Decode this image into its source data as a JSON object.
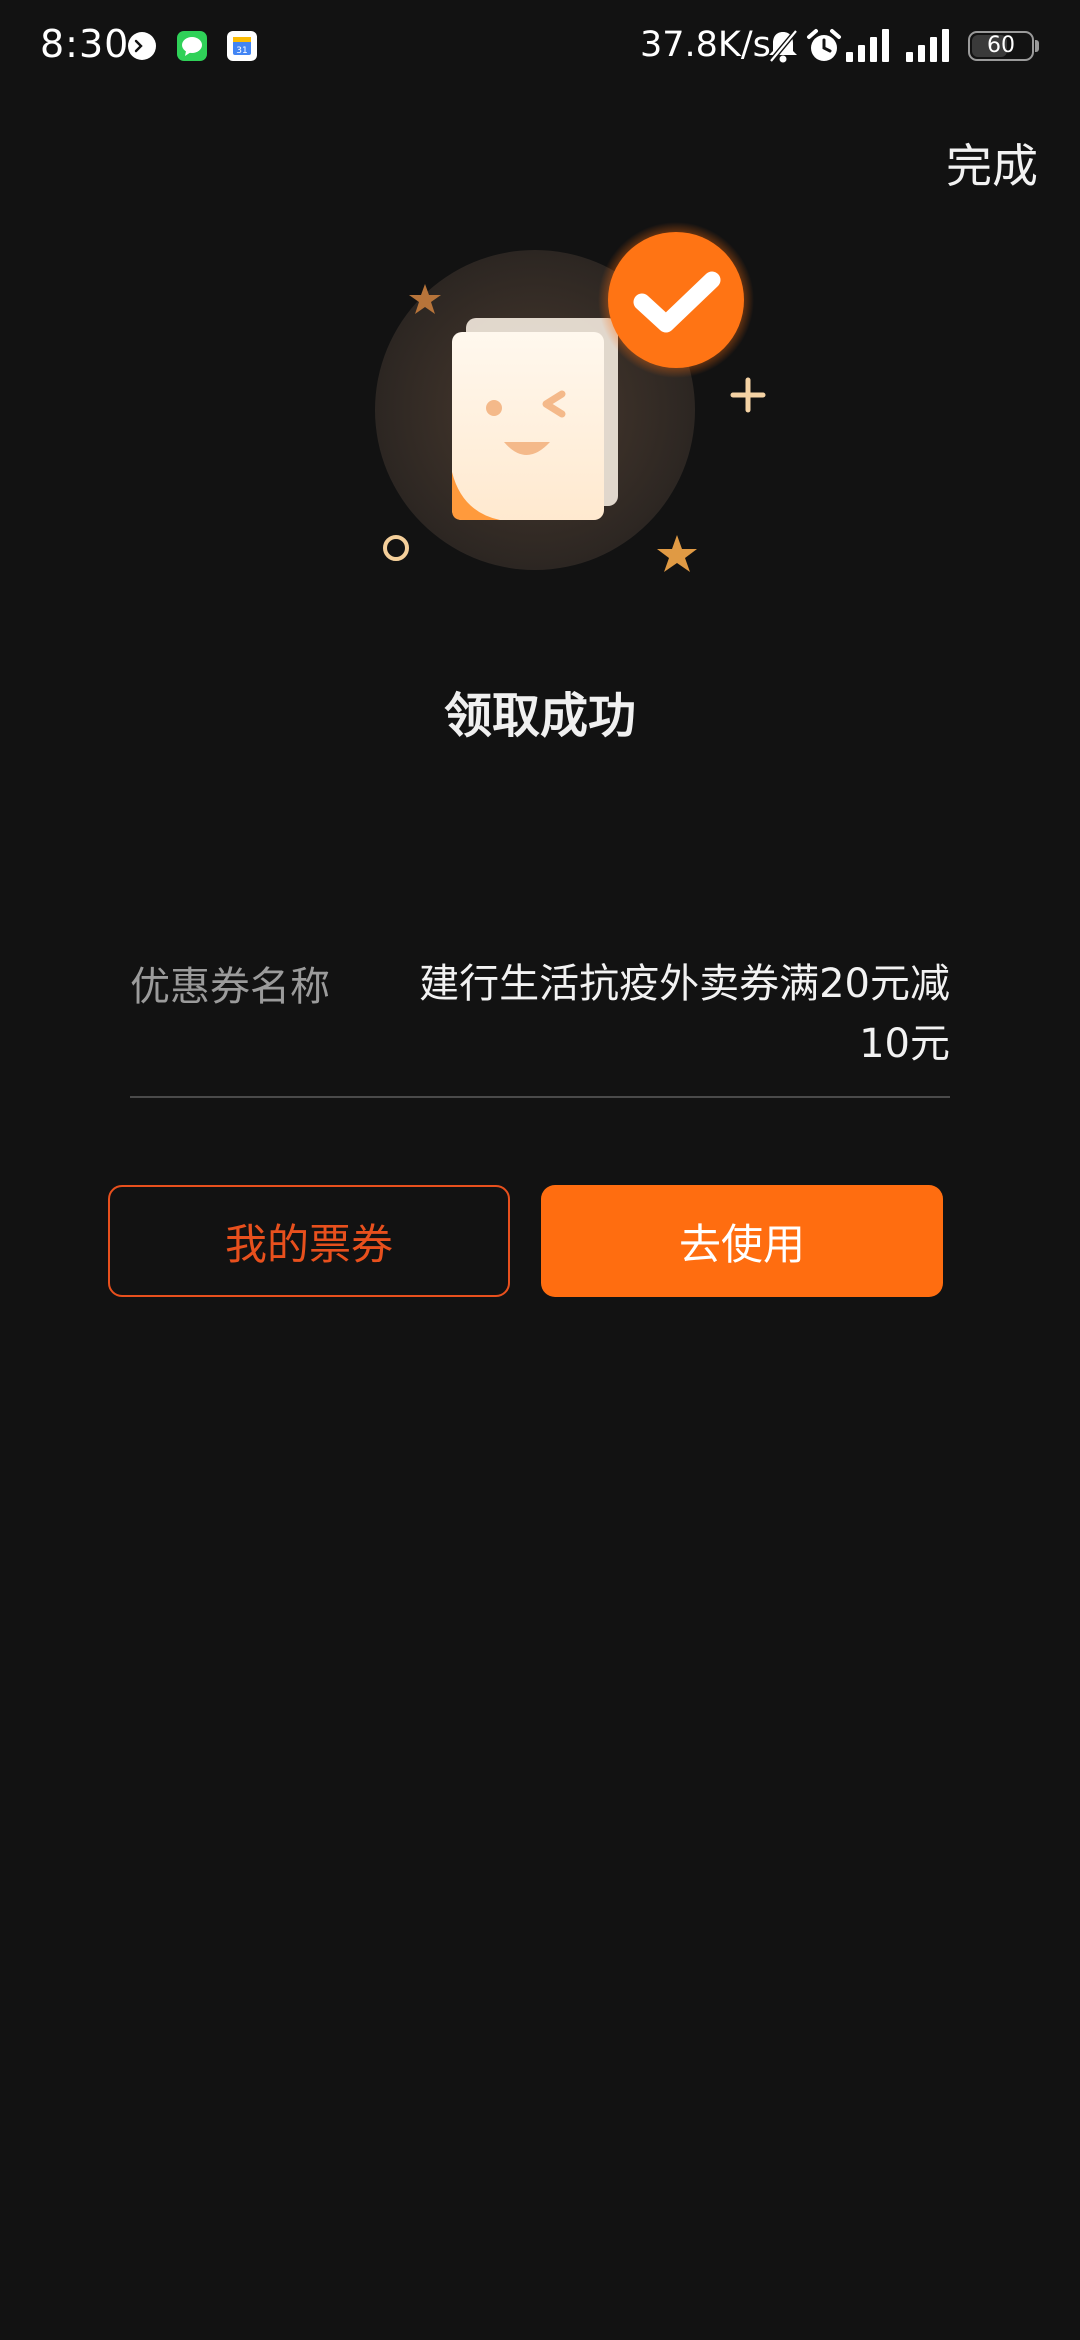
{
  "status_bar": {
    "time": "8:30",
    "net_speed": "37.8K/s",
    "battery_level": "60",
    "battery_fraction": 0.6,
    "icons": [
      "terminal-app-icon",
      "messages-app-icon",
      "calendar-app-icon",
      "bell-muted-icon",
      "alarm-icon",
      "signal-icon",
      "signal-icon-2"
    ]
  },
  "header": {
    "done_label": "完成"
  },
  "result": {
    "title": "领取成功"
  },
  "coupon": {
    "label": "优惠券名称",
    "value": "建行生活抗疫外卖券满20元减10元"
  },
  "buttons": {
    "my_tickets": "我的票券",
    "use_now": "去使用"
  },
  "colors": {
    "background": "#121212",
    "accent": "#ff6d10",
    "outline_accent": "#e8501d"
  }
}
